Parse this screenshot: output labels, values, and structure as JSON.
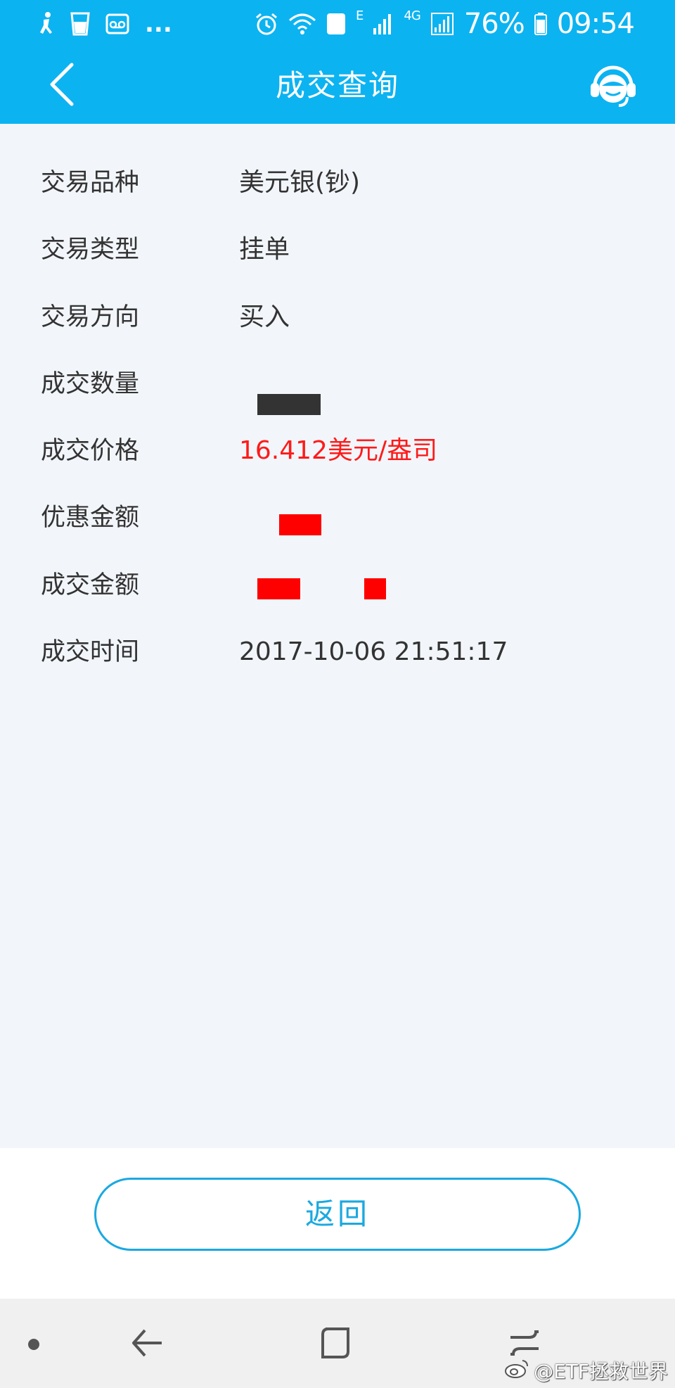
{
  "status_bar": {
    "overflow": "...",
    "sim_slot": "2",
    "network_e": "E",
    "network_4g": "4G",
    "battery": "76%",
    "time": "09:54",
    "icons_left": [
      "runner-icon",
      "cup-icon",
      "voicemail-icon"
    ],
    "icons_right": [
      "alarm-icon",
      "wifi-icon",
      "signal-icon",
      "battery-icon"
    ]
  },
  "nav": {
    "title": "成交查询",
    "back_icon": "chevron-left-icon",
    "support_icon": "customer-service-icon"
  },
  "details": [
    {
      "label": "交易品种",
      "value": "美元银(钞)"
    },
    {
      "label": "交易类型",
      "value": "挂单"
    },
    {
      "label": "交易方向",
      "value": "买入"
    },
    {
      "label": "成交数量",
      "value": ""
    },
    {
      "label": "成交价格",
      "value": "16.412美元/盎司"
    },
    {
      "label": "优惠金额",
      "value": ""
    },
    {
      "label": "成交金额",
      "value": ""
    },
    {
      "label": "成交时间",
      "value": "2017-10-06 21:51:17"
    }
  ],
  "colors": {
    "header": "#0cb3f1",
    "accent": "#1aa9e0",
    "price": "#ff1a1a",
    "redaction_dark": "#333333",
    "redaction_red": "#ff0000"
  },
  "actions": {
    "return_label": "返回"
  },
  "system_nav": {
    "icons": [
      "dot-icon",
      "back-arrow-icon",
      "recents-icon",
      "switch-icon"
    ]
  },
  "watermark": {
    "text": "@ETF拯救世界"
  }
}
